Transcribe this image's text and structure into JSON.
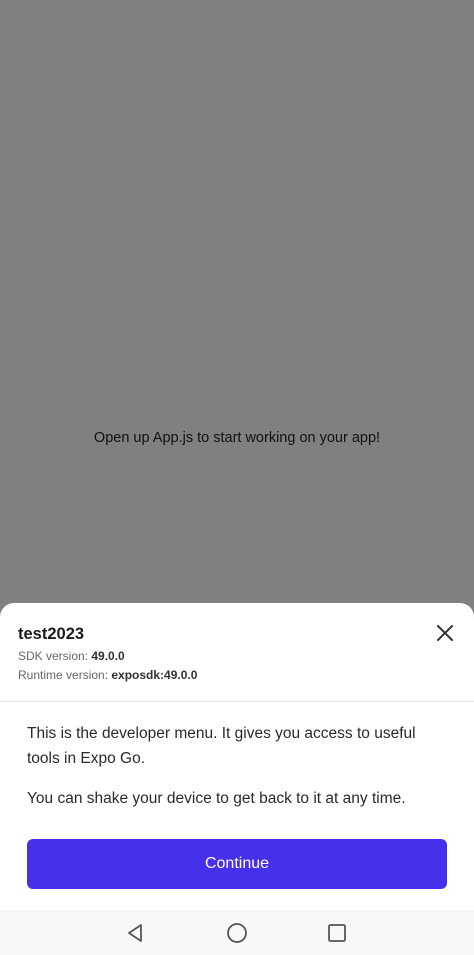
{
  "app": {
    "message": "Open up App.js to start working on your app!"
  },
  "dev_menu": {
    "app_name": "test2023",
    "sdk_label": "SDK version: ",
    "sdk_value": "49.0.0",
    "runtime_label": "Runtime version: ",
    "runtime_value": "exposdk:49.0.0",
    "paragraph_1": "This is the developer menu. It gives you access to useful tools in Expo Go.",
    "paragraph_2": "You can shake your device to get back to it at any time.",
    "continue_label": "Continue",
    "close_icon": "close-icon"
  },
  "navigation": {
    "icons": [
      "back-triangle-icon",
      "home-circle-icon",
      "recents-square-icon"
    ]
  },
  "colors": {
    "backdrop": "#808080",
    "accent": "#4630eb",
    "sheet": "#ffffff"
  }
}
